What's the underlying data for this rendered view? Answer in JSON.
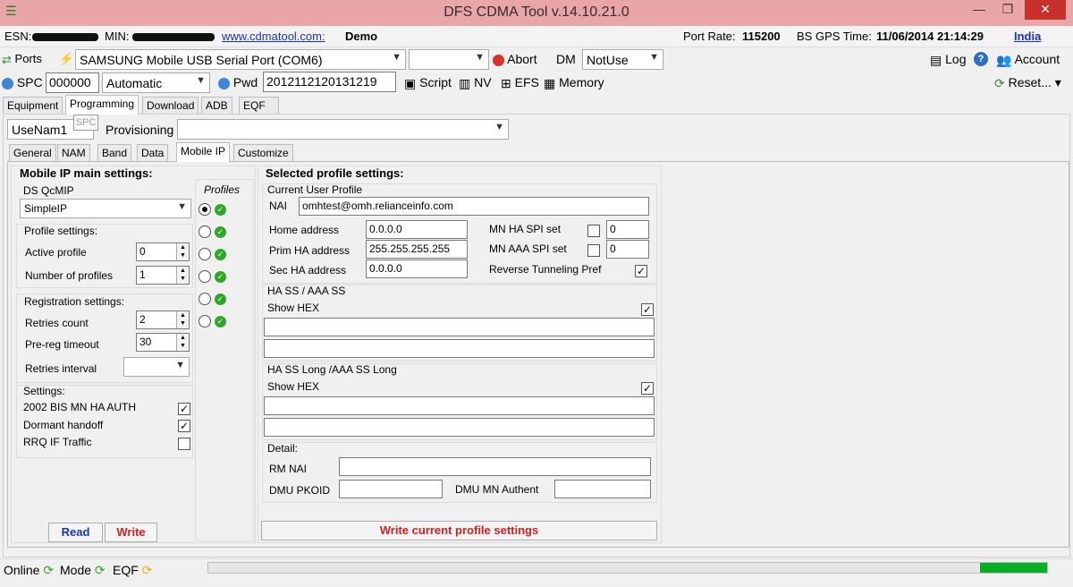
{
  "window": {
    "title": "DFS CDMA Tool v.14.10.21.0",
    "minimize": "—",
    "maximize": "❐",
    "close": "✕"
  },
  "info": {
    "esn_label": "ESN:",
    "min_label": "MIN:",
    "website": "www.cdmatool.com:",
    "mode": "Demo",
    "port_rate_label": "Port Rate:",
    "port_rate": "115200",
    "gps_label": "BS GPS Time:",
    "gps_time": "11/06/2014 21:14:29",
    "region": "India"
  },
  "toolbar1": {
    "ports": "Ports",
    "port_select": "SAMSUNG Mobile USB Serial Port  (COM6)",
    "second_select": "",
    "abort": "Abort",
    "dm_label": "DM",
    "dm_select": "NotUse",
    "log": "Log",
    "help": "?",
    "account": "Account"
  },
  "toolbar2": {
    "spc_label": "SPC",
    "spc_value": "000000",
    "spc_mode": "Automatic",
    "pwd_label": "Pwd",
    "pwd_value": "2012112120131219",
    "script": "Script",
    "nv": "NV",
    "efs": "EFS",
    "memory": "Memory",
    "reset": "Reset..."
  },
  "main_tabs": [
    "Equipment",
    "Programming",
    "Download",
    "ADB",
    "EQF"
  ],
  "spc_tooltip": "SPC",
  "nam_select": "UseNam1",
  "provisioning_label": "Provisioning",
  "provisioning_select": "",
  "sub_tabs": [
    "General",
    "NAM",
    "Band",
    "Data",
    "Mobile IP",
    "Customize"
  ],
  "left": {
    "title": "Mobile IP main settings:",
    "ds_qcmip": "DS QcMIP",
    "ds_select": "SimpleIP",
    "profiles_header": "Profiles",
    "profile_settings": "Profile settings:",
    "active_profile_label": "Active profile",
    "active_profile": "0",
    "num_profiles_label": "Number of profiles",
    "num_profiles": "1",
    "registration": "Registration settings:",
    "retries_label": "Retries count",
    "retries": "2",
    "prereg_label": "Pre-reg timeout",
    "prereg": "30",
    "interval_label": "Retries interval",
    "interval": "",
    "settings": "Settings:",
    "opt1": "2002 BIS MN HA AUTH",
    "opt2": "Dormant handoff",
    "opt3": "RRQ IF Traffic",
    "opt1_checked": true,
    "opt2_checked": true,
    "opt3_checked": false,
    "read": "Read",
    "write": "Write"
  },
  "profiles": [
    {
      "selected": true
    },
    {
      "selected": false
    },
    {
      "selected": false
    },
    {
      "selected": false
    },
    {
      "selected": false
    },
    {
      "selected": false
    }
  ],
  "right": {
    "title": "Selected profile settings:",
    "current_user_profile": "Current User Profile",
    "nai_label": "NAI",
    "nai": "omhtest@omh.relianceinfo.com",
    "home_label": "Home address",
    "home": "0.0.0.0",
    "prim_label": "Prim HA address",
    "prim": "255.255.255.255",
    "sec_label": "Sec HA address",
    "sec": "0.0.0.0",
    "mnha_label": "MN HA SPI set",
    "mnha": "0",
    "mnaaa_label": "MN AAA SPI set",
    "mnaaa": "0",
    "reverse_label": "Reverse Tunneling Pref",
    "ha_ss_title": "HA SS / AAA SS",
    "show_hex": "Show HEX",
    "ha_ss_long_title": "HA SS Long /AAA SS Long",
    "detail": "Detail:",
    "rm_nai_label": "RM NAI",
    "dmu_pkoid_label": "DMU PKOID",
    "dmu_mn_label": "DMU MN Authent",
    "write_btn": "Write current profile settings"
  },
  "status": {
    "online": "Online",
    "mode": "Mode",
    "eqf": "EQF",
    "progress": 0.08
  }
}
